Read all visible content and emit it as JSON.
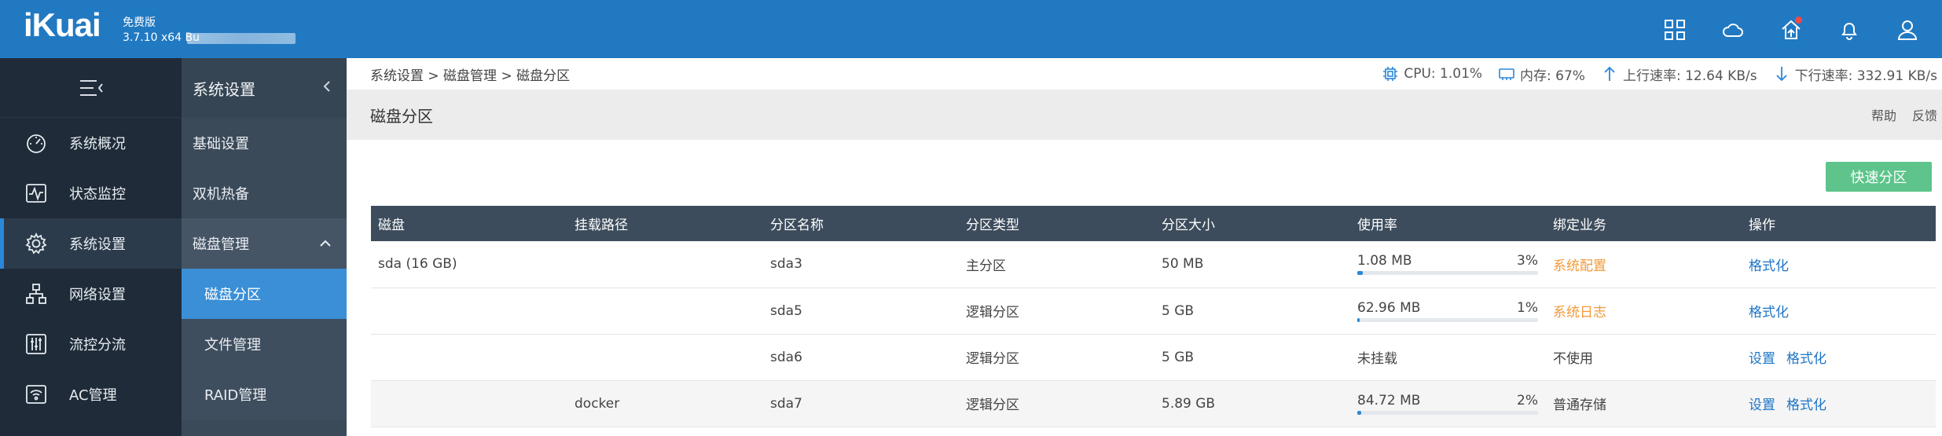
{
  "header": {
    "logo": "iKuai",
    "edition": "免费版",
    "version": "3.7.10 x64 Bu"
  },
  "top_icons": [
    "apps-grid-icon",
    "cloud-icon",
    "home-upgrade-icon",
    "bell-icon",
    "user-icon"
  ],
  "leftnav": {
    "items": [
      {
        "label": "系统概况",
        "icon": "gauge-icon"
      },
      {
        "label": "状态监控",
        "icon": "monitor-pulse-icon"
      },
      {
        "label": "系统设置",
        "icon": "gear-icon",
        "active": true
      },
      {
        "label": "网络设置",
        "icon": "network-icon"
      },
      {
        "label": "流控分流",
        "icon": "sliders-icon"
      },
      {
        "label": "AC管理",
        "icon": "wifi-ap-icon"
      }
    ]
  },
  "subnav": {
    "title": "系统设置",
    "items": [
      {
        "label": "基础设置"
      },
      {
        "label": "双机热备"
      },
      {
        "label": "磁盘管理"
      }
    ],
    "children": [
      {
        "label": "磁盘分区",
        "active": true
      },
      {
        "label": "文件管理"
      },
      {
        "label": "RAID管理"
      }
    ]
  },
  "breadcrumb": "系统设置 > 磁盘管理 > 磁盘分区",
  "stats": {
    "cpu": "CPU: 1.01%",
    "mem": "内存: 67%",
    "up": "上行速率: 12.64 KB/s",
    "down": "下行速率: 332.91 KB/s"
  },
  "page": {
    "title": "磁盘分区",
    "help": "帮助",
    "feedback": "反馈",
    "quick_partition": "快速分区"
  },
  "table": {
    "columns": [
      "磁盘",
      "挂载路径",
      "分区名称",
      "分区类型",
      "分区大小",
      "使用率",
      "绑定业务",
      "操作"
    ],
    "rows": [
      {
        "disk": "sda (16 GB)",
        "mount": "",
        "name": "sda3",
        "type": "主分区",
        "size": "50 MB",
        "used": "1.08 MB",
        "pct": "3%",
        "pct_value": 0.03,
        "service": "系统配置",
        "ops": [
          "格式化"
        ]
      },
      {
        "disk": "",
        "mount": "",
        "name": "sda5",
        "type": "逻辑分区",
        "size": "5 GB",
        "used": "62.96 MB",
        "pct": "1%",
        "pct_value": 0.01,
        "service": "系统日志",
        "ops": [
          "格式化"
        ]
      },
      {
        "disk": "",
        "mount": "",
        "name": "sda6",
        "type": "逻辑分区",
        "size": "5 GB",
        "used": "未挂载",
        "pct": "",
        "pct_value": null,
        "service": "不使用",
        "ops": [
          "设置",
          "格式化"
        ]
      },
      {
        "disk": "",
        "mount": "docker",
        "name": "sda7",
        "type": "逻辑分区",
        "size": "5.89 GB",
        "used": "84.72 MB",
        "pct": "2%",
        "pct_value": 0.02,
        "service": "普通存储",
        "ops": [
          "设置",
          "格式化"
        ]
      }
    ]
  },
  "colors": {
    "topbar": "#2179c2",
    "nav_bg": "#1f2b38",
    "subnav_bg": "#3b4a59",
    "active_blue": "#3a8fd6",
    "header_row": "#3c4c5c",
    "quick_btn": "#5ec48b",
    "service_orange": "#f29a3b",
    "link_blue": "#1d74c6"
  }
}
